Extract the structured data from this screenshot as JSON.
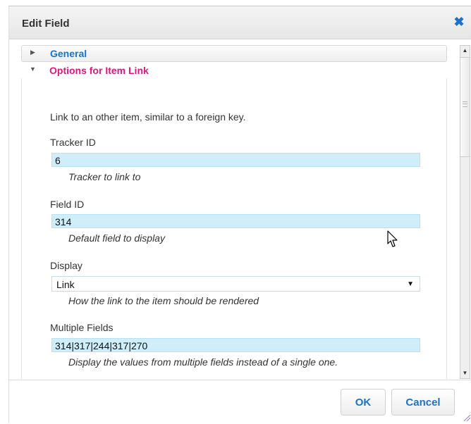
{
  "dialog": {
    "title": "Edit Field",
    "close_icon": "close-icon"
  },
  "accordion": {
    "general_label": "General",
    "options_label": "Options for Item Link"
  },
  "options": {
    "intro": "Link to an other item, similar to a foreign key.",
    "tracker_id": {
      "label": "Tracker ID",
      "value": "6",
      "help": "Tracker to link to"
    },
    "field_id": {
      "label": "Field ID",
      "value": "314",
      "help": "Default field to display"
    },
    "display": {
      "label": "Display",
      "selected": "Link",
      "help": "How the link to the item should be rendered"
    },
    "multiple_fields": {
      "label": "Multiple Fields",
      "value": "314|317|244|317|270",
      "help": "Display the values from multiple fields instead of a single one."
    }
  },
  "buttons": {
    "ok_label": "OK",
    "cancel_label": "Cancel"
  },
  "colors": {
    "link_blue": "#1a73c8",
    "active_header_pink": "#e0177a",
    "input_fill": "#cfeefa"
  }
}
